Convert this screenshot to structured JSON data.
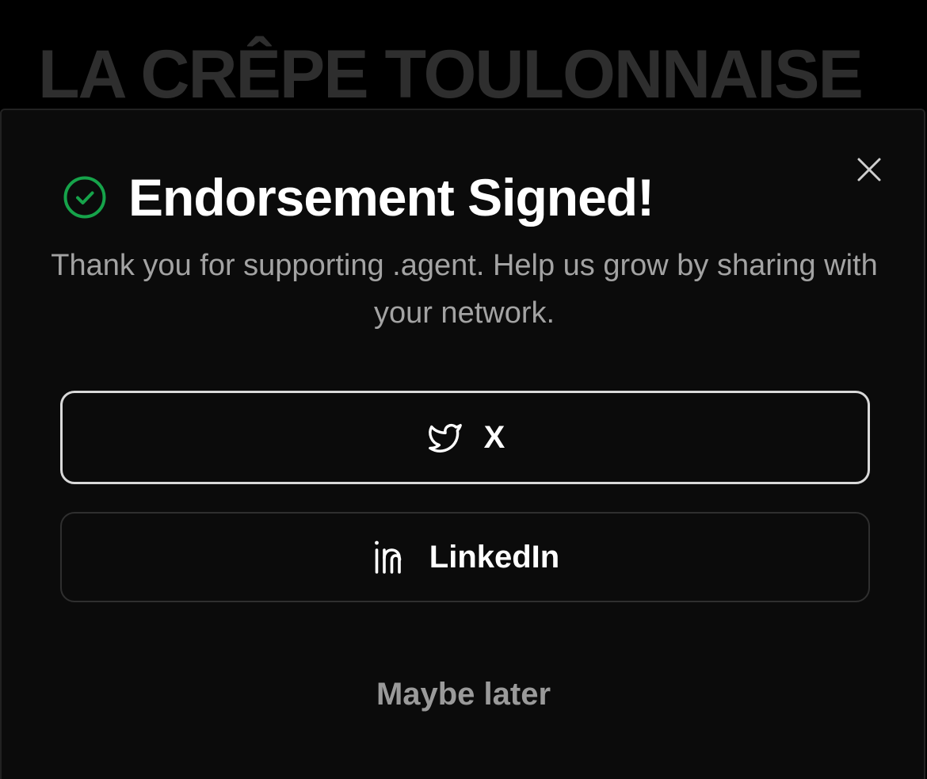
{
  "background": {
    "title": "LA CRÊPE TOULONNAISE"
  },
  "modal": {
    "title": "Endorsement Signed!",
    "subtitle": "Thank you for supporting .agent. Help us grow by sharing with your network.",
    "status_icon": "check-circle-icon",
    "close_icon": "close-icon",
    "buttons": [
      {
        "label": "X",
        "icon": "twitter-bird-icon"
      },
      {
        "label": "LinkedIn",
        "icon": "linkedin-icon"
      }
    ],
    "dismiss_label": "Maybe later"
  },
  "colors": {
    "success": "#16a34a",
    "modal_bg": "#0b0b0b",
    "page_bg": "#000000",
    "muted_text": "#a3a3a3",
    "background_title": "#2e2e2e",
    "focused_border": "#d9d9d9"
  }
}
